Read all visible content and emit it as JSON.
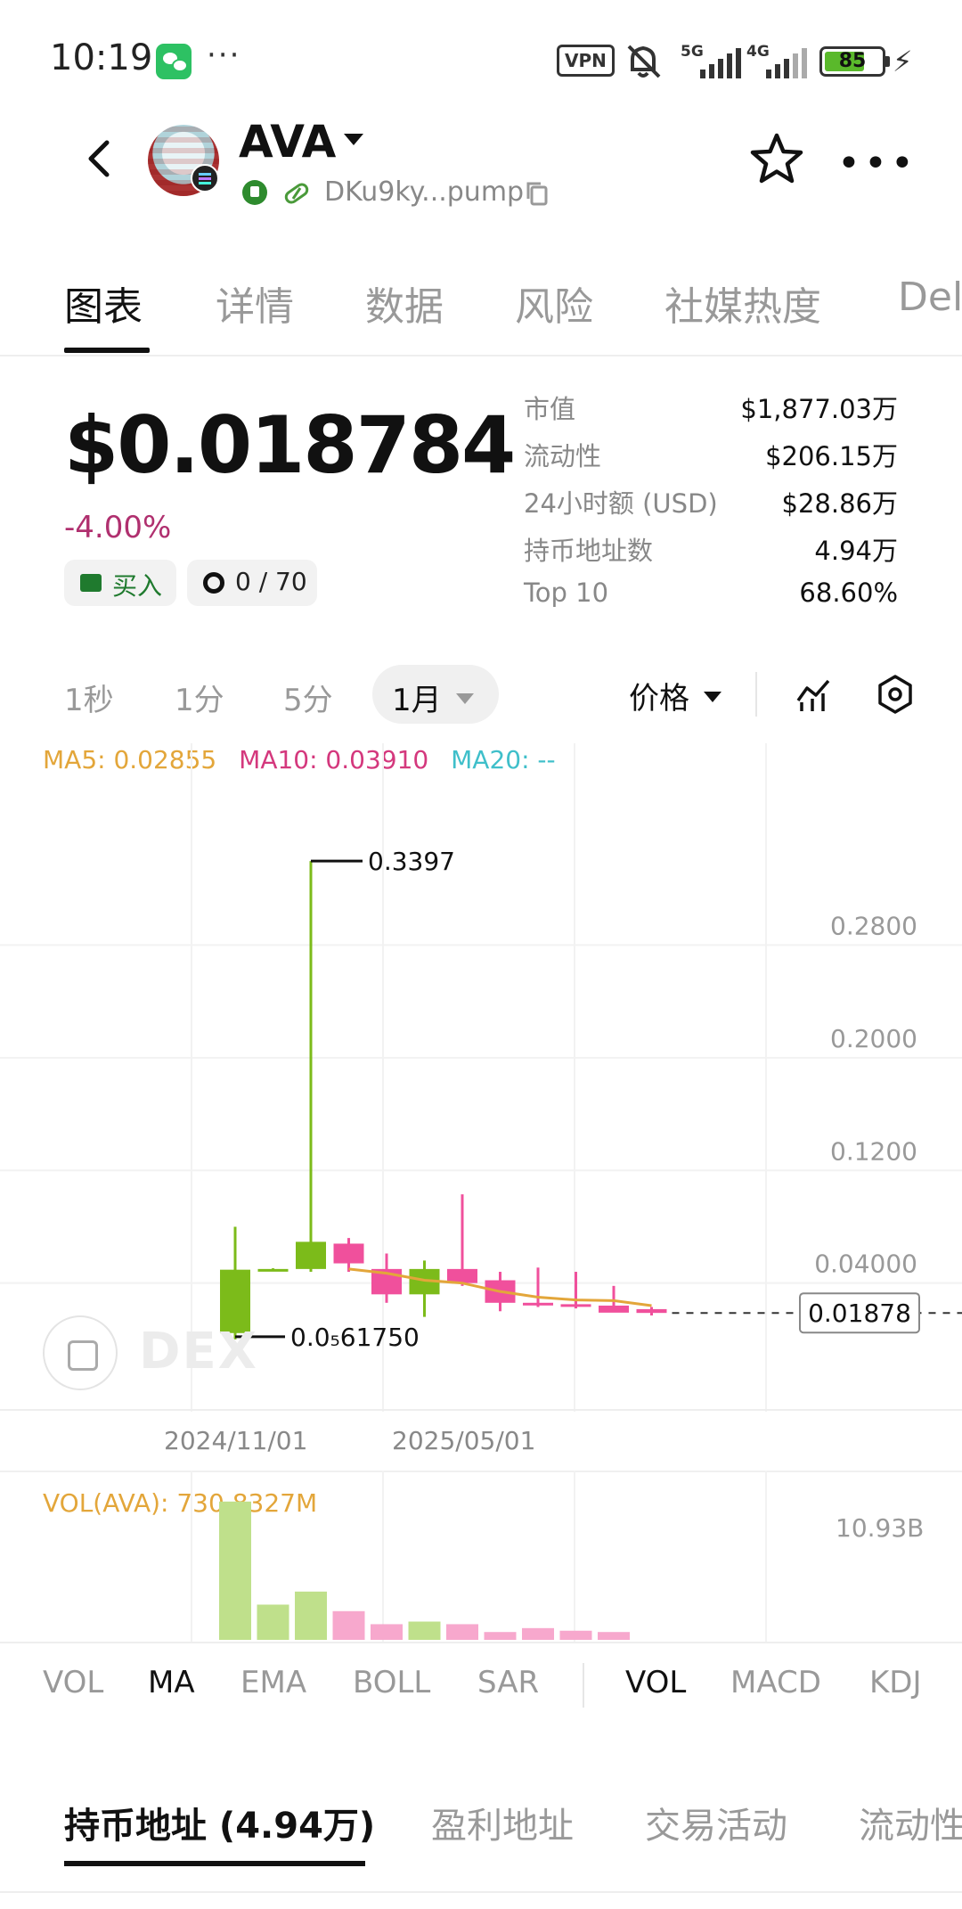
{
  "status_bar": {
    "time": "10:19",
    "more": "···",
    "vpn": "VPN",
    "signal_5g": "5G",
    "signal_4g": "4G",
    "battery": "85",
    "icons": [
      "wechat-icon",
      "mute-icon",
      "signal-icon",
      "battery-icon",
      "charging-icon"
    ]
  },
  "header": {
    "token_name": "AVA",
    "address": "DKu9ky...pump",
    "more": "•••",
    "icons": [
      "back-icon",
      "avatar",
      "verified-icon",
      "pill-icon",
      "copy-icon",
      "star-icon",
      "more-icon"
    ]
  },
  "tabs": [
    "图表",
    "详情",
    "数据",
    "风险",
    "社媒热度",
    "Del"
  ],
  "price": {
    "value": "$0.018784",
    "change": "-4.00%",
    "change_color": "#b0306f",
    "buy_label": "买入",
    "snipe_label": "0 / 70"
  },
  "stats": [
    {
      "label": "市值",
      "value": "$1,877.03万"
    },
    {
      "label": "流动性",
      "value": "$206.15万"
    },
    {
      "label": "24小时额 (USD)",
      "value": "$28.86万"
    },
    {
      "label": "持币地址数",
      "value": "4.94万"
    },
    {
      "label": "Top 10",
      "value": "68.60%"
    }
  ],
  "intervals": {
    "options": [
      "1秒",
      "1分",
      "5分"
    ],
    "selected": "1月",
    "price_select": "价格"
  },
  "ma_legend": {
    "ma5": "MA5: 0.02855",
    "ma10": "MA10: 0.03910",
    "ma20": "MA20: --",
    "ma5_color": "#e3a63a",
    "ma10_color": "#d4387d",
    "ma20_color": "#3fbfca"
  },
  "chart_data": {
    "type": "candlestick",
    "y_ticks": [
      "0.2800",
      "0.2000",
      "0.1200",
      "0.04000"
    ],
    "y_tick_values": [
      0.28,
      0.2,
      0.12,
      0.04
    ],
    "ylim": [
      -0.045,
      0.36
    ],
    "x_labels": [
      "2024/11/01",
      "2025/05/01"
    ],
    "max_label": "0.3397",
    "min_label": "0.0₅61750",
    "current_price_label": "0.01878",
    "current_price": 0.01878,
    "up_color": "#7cbb1a",
    "down_color": "#f0509c",
    "candles": [
      {
        "open": 0.0045,
        "high": 0.08,
        "low": 6.2e-06,
        "close": 0.0495
      },
      {
        "open": 0.0495,
        "high": 0.0505,
        "low": 0.049,
        "close": 0.05
      },
      {
        "open": 0.05,
        "high": 0.3397,
        "low": 0.048,
        "close": 0.0693
      },
      {
        "open": 0.068,
        "high": 0.072,
        "low": 0.048,
        "close": 0.054
      },
      {
        "open": 0.05,
        "high": 0.061,
        "low": 0.026,
        "close": 0.032
      },
      {
        "open": 0.032,
        "high": 0.056,
        "low": 0.016,
        "close": 0.05
      },
      {
        "open": 0.05,
        "high": 0.103,
        "low": 0.038,
        "close": 0.04
      },
      {
        "open": 0.042,
        "high": 0.048,
        "low": 0.02,
        "close": 0.026
      },
      {
        "open": 0.026,
        "high": 0.051,
        "low": 0.023,
        "close": 0.025
      },
      {
        "open": 0.025,
        "high": 0.048,
        "low": 0.022,
        "close": 0.0245
      },
      {
        "open": 0.024,
        "high": 0.038,
        "low": 0.021,
        "close": 0.019
      },
      {
        "open": 0.0215,
        "high": 0.023,
        "low": 0.017,
        "close": 0.0188
      }
    ],
    "ma_line": [
      0.05,
      0.047,
      0.042,
      0.04,
      0.034,
      0.03,
      0.028,
      0.0275,
      0.024
    ],
    "volume": {
      "legend": "VOL(AVA): 730.8327M",
      "axis_label": "10.93B",
      "max": 10.93,
      "bars": [
        {
          "value": 10.6,
          "up": true
        },
        {
          "value": 2.7,
          "up": true
        },
        {
          "value": 3.7,
          "up": true
        },
        {
          "value": 2.2,
          "up": false
        },
        {
          "value": 1.2,
          "up": false
        },
        {
          "value": 1.4,
          "up": true
        },
        {
          "value": 1.2,
          "up": false
        },
        {
          "value": 0.6,
          "up": false
        },
        {
          "value": 0.9,
          "up": false
        },
        {
          "value": 0.7,
          "up": false
        },
        {
          "value": 0.6,
          "up": false
        }
      ]
    }
  },
  "watermark": "DEX",
  "indicator_tabs": {
    "main": [
      "VOL",
      "MA",
      "EMA",
      "BOLL",
      "SAR"
    ],
    "main_active": "MA",
    "sub": [
      "VOL",
      "MACD",
      "KDJ"
    ],
    "sub_active": "VOL"
  },
  "bottom_tabs": [
    "持币地址 (4.94万)",
    "盈利地址",
    "交易活动",
    "流动性"
  ]
}
